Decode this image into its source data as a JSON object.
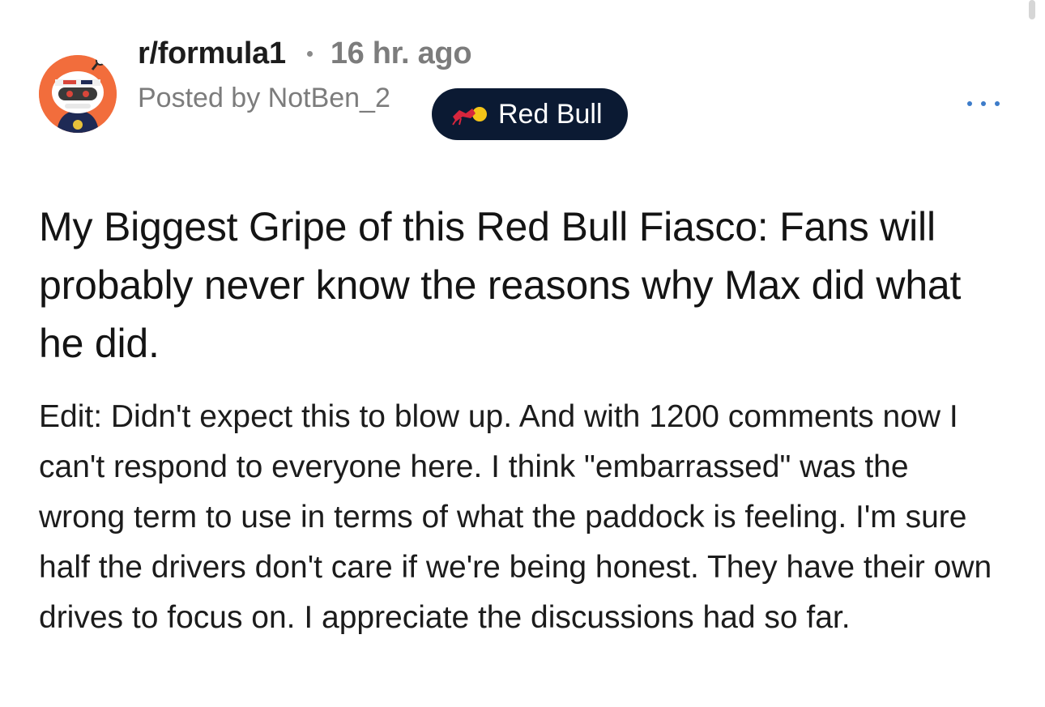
{
  "post": {
    "subreddit": "r/formula1",
    "time_ago": "16 hr. ago",
    "posted_by": "Posted by NotBen_2",
    "flair": {
      "label": "Red Bull",
      "icon": "red-bull-icon",
      "background": "#0b1a33"
    },
    "more_icon": "more-options-icon",
    "title": "My Biggest Gripe of this Red Bull Fiasco: Fans will probably never know the reasons why Max did what he did.",
    "body": "Edit: Didn't expect this to blow up. And with 1200 comments now I can't respond to everyone here. I think \"embarrassed\" was the wrong term to use in terms of what the paddock is feeling. I'm sure half the drivers don't care if we're being honest. They have their own drives to focus on. I appreciate the discussions had so far."
  },
  "avatar": {
    "icon": "snoo-avatar-icon",
    "background": "#f26d3c"
  },
  "colors": {
    "accent": "#3d7cc9",
    "muted_text": "#7c7c7c"
  }
}
